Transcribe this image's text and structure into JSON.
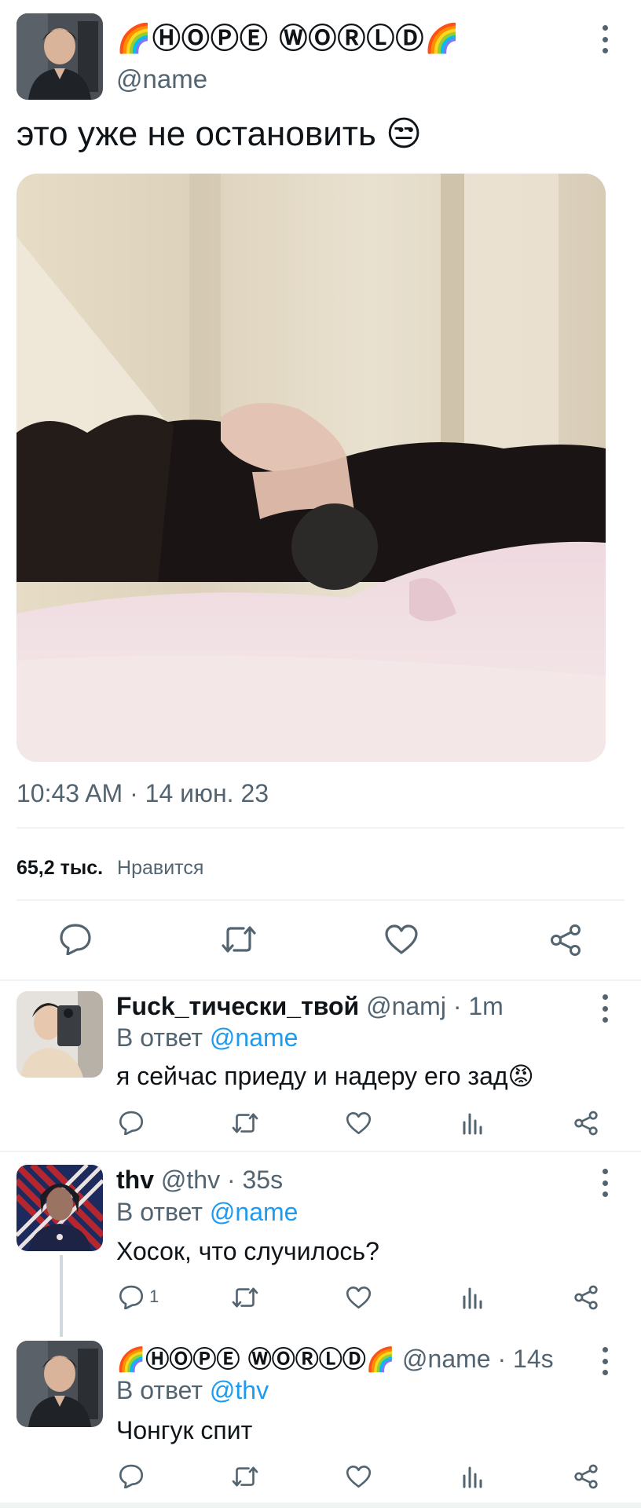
{
  "main_tweet": {
    "display_name": "🌈ⒽⓄⓅⒺ ⓌⓄⓇⓁⒹ🌈",
    "handle": "@name",
    "text": "это уже не остановить 😒",
    "timestamp": "10:43 AM · 14 июн. 23",
    "likes_count": "65,2 тыс.",
    "likes_label": "Нравится",
    "icons": [
      "reply-icon",
      "retweet-icon",
      "like-icon",
      "share-icon"
    ]
  },
  "replies": [
    {
      "display_name": "Fuck_тически_твой",
      "handle": "@namj",
      "time": "· 1m",
      "reply_to_label": "В ответ",
      "reply_to_handle": "@name",
      "text": "я сейчас приеду и надеру его зад😡",
      "reply_count": ""
    },
    {
      "display_name": "thv",
      "handle": "@thv",
      "time": "· 35s",
      "reply_to_label": "В ответ",
      "reply_to_handle": "@name",
      "text": "Хосок,  что случилось?",
      "reply_count": "1"
    },
    {
      "display_name": "🌈ⒽⓄⓅⒺ ⓌⓄⓇⓁⒹ🌈",
      "handle": "@name",
      "time": "· 14s",
      "reply_to_label": "В ответ",
      "reply_to_handle": "@thv",
      "text": "Чонгук спит",
      "reply_count": ""
    }
  ],
  "colors": {
    "text": "#0f1419",
    "secondary": "#536471",
    "link": "#1d9bf0",
    "divider": "#eff3f4"
  }
}
